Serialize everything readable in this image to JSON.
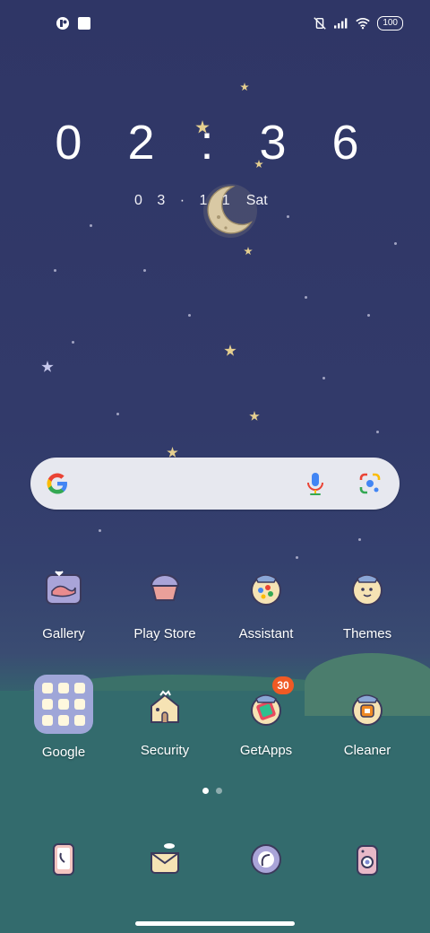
{
  "status_bar": {
    "left_icons": [
      "notification-app-icon",
      "square-notification-icon"
    ],
    "right_icons": [
      "vibrate-off-icon",
      "signal-icon",
      "wifi-icon"
    ],
    "battery": "100"
  },
  "clock": {
    "time": "0 2 : 3 6",
    "date_digits": "0 3 · 1 1",
    "weekday": "Sat"
  },
  "search": {
    "icons": [
      "google-g-icon",
      "mic-icon",
      "google-lens-icon"
    ]
  },
  "apps_row1": [
    {
      "label": "Gallery",
      "icon": "gallery-icon"
    },
    {
      "label": "Play Store",
      "icon": "play-store-icon"
    },
    {
      "label": "Assistant",
      "icon": "assistant-icon"
    },
    {
      "label": "Themes",
      "icon": "themes-icon"
    }
  ],
  "apps_row2": [
    {
      "label": "Google",
      "icon": "google-folder-icon"
    },
    {
      "label": "Security",
      "icon": "security-icon"
    },
    {
      "label": "GetApps",
      "icon": "getapps-icon",
      "badge": "30"
    },
    {
      "label": "Cleaner",
      "icon": "cleaner-icon"
    }
  ],
  "dock": [
    "phone-icon",
    "messages-icon",
    "browser-icon",
    "camera-icon"
  ],
  "pager": {
    "pages": 2,
    "current": 1
  },
  "colors": {
    "sky": "#2f3666",
    "meadow": "#336b6d",
    "badge": "#f05a24"
  }
}
